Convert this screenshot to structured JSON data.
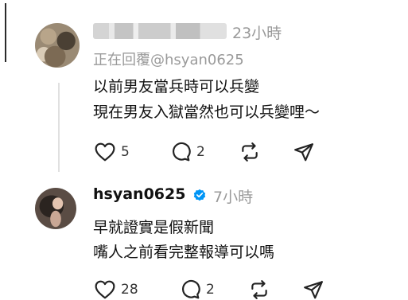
{
  "comment": {
    "time": "23小時",
    "reply_to": "正在回覆@hsyan0625",
    "lines": [
      "以前男友當兵時可以兵變",
      "現在男友入獄當然也可以兵變哩～"
    ],
    "likes": "5",
    "replies": "2"
  },
  "reply": {
    "username": "hsyan0625",
    "time": "7小時",
    "lines": [
      "早就證實是假新聞",
      "嘴人之前看完整報導可以嗎"
    ],
    "likes": "28",
    "replies": "2"
  },
  "icons": {
    "like": "heart-icon",
    "reply": "comment-bubble-icon",
    "repost": "repost-icon",
    "share": "send-icon",
    "verified": "verified-badge-icon"
  },
  "colors": {
    "verified_badge": "#0095f6",
    "muted_text": "#999999",
    "text": "#111111"
  }
}
